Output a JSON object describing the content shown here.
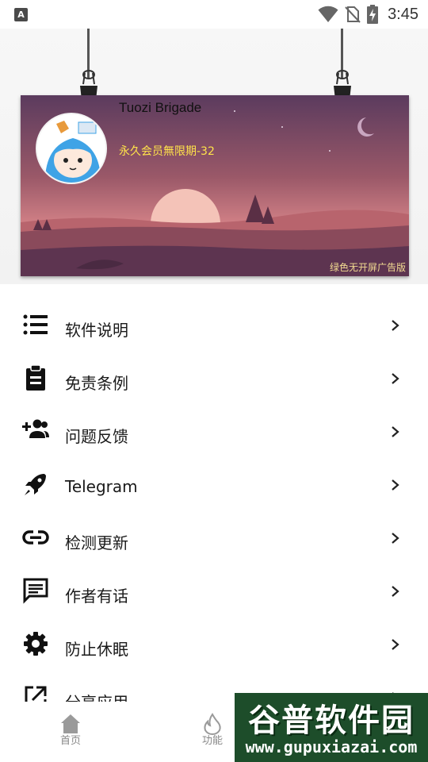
{
  "status_bar": {
    "app_icon_letter": "A",
    "time": "3:45",
    "icons": [
      "wifi-icon",
      "no-sim-icon",
      "battery-charging-icon"
    ]
  },
  "profile": {
    "name": "Tuozi Brigade",
    "membership": "永久会员無限期-32",
    "ad_tag": "绿色无开屏广告版"
  },
  "menu": {
    "items": [
      {
        "label": "软件说明",
        "icon": "list-icon"
      },
      {
        "label": "免责条例",
        "icon": "clipboard-icon"
      },
      {
        "label": "问题反馈",
        "icon": "add-user-icon"
      },
      {
        "label": "Telegram",
        "icon": "rocket-icon"
      },
      {
        "label": "检测更新",
        "icon": "link-icon"
      },
      {
        "label": "作者有话",
        "icon": "message-icon"
      },
      {
        "label": "防止休眠",
        "icon": "gear-icon"
      },
      {
        "label": "分享应用",
        "icon": "share-icon"
      }
    ]
  },
  "bottom_nav": {
    "items": [
      {
        "label": "首页",
        "icon": "home-icon"
      },
      {
        "label": "功能",
        "icon": "fire-icon"
      }
    ]
  },
  "watermark": {
    "title": "谷普软件园",
    "url": "www.gupuxiazai.com"
  },
  "colors": {
    "membership_text": "#ffe34a",
    "ad_tag_text": "#f3dc92",
    "watermark_bg": "#1d4d2a"
  }
}
